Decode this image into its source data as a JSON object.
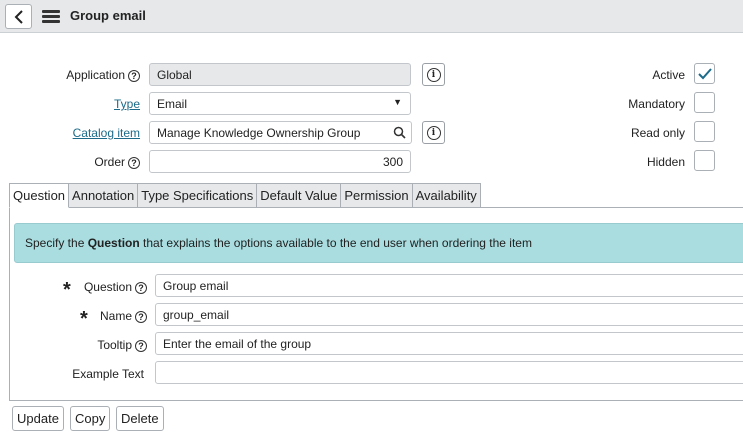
{
  "header": {
    "title": "Group email",
    "back_icon": "chevron-left-icon",
    "menu_icon": "hamburger-menu-icon"
  },
  "form": {
    "application": {
      "label": "Application",
      "value": "Global"
    },
    "type": {
      "label": "Type",
      "value": "Email"
    },
    "catalog_item": {
      "label": "Catalog item",
      "value": "Manage Knowledge Ownership Group"
    },
    "order": {
      "label": "Order",
      "value": "300"
    },
    "active": {
      "label": "Active",
      "checked": true
    },
    "mandatory": {
      "label": "Mandatory",
      "checked": false
    },
    "read_only": {
      "label": "Read only",
      "checked": false
    },
    "hidden": {
      "label": "Hidden",
      "checked": false
    }
  },
  "tabs": [
    {
      "label": "Question",
      "active": true
    },
    {
      "label": "Annotation",
      "active": false
    },
    {
      "label": "Type Specifications",
      "active": false
    },
    {
      "label": "Default Value",
      "active": false
    },
    {
      "label": "Permission",
      "active": false
    },
    {
      "label": "Availability",
      "active": false
    }
  ],
  "banner": {
    "prefix": "Specify the ",
    "bold": "Question",
    "suffix": " that explains the options available to the end user when ordering the item"
  },
  "question_tab": {
    "question": {
      "label": "Question",
      "value": "Group email"
    },
    "name": {
      "label": "Name",
      "value": "group_email"
    },
    "tooltip": {
      "label": "Tooltip",
      "value": "Enter the email of the group"
    },
    "example_text": {
      "label": "Example Text",
      "value": ""
    }
  },
  "buttons": {
    "update": "Update",
    "copy": "Copy",
    "delete": "Delete"
  },
  "colors": {
    "header_bg": "#e6e8ea",
    "banner_bg": "#a9dde0",
    "link": "#1c6b8a",
    "check": "#1c6b8a"
  }
}
